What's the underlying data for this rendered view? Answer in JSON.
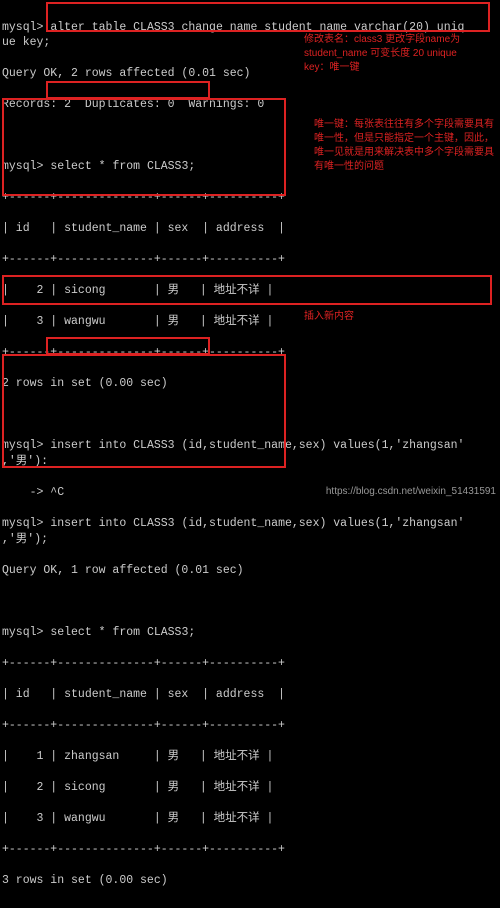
{
  "prompt": "mysql>",
  "statements": {
    "alter": "alter table CLASS3 change name student_name varchar(20) uniq\nue key;",
    "alter_result1": "Query OK, 2 rows affected (0.01 sec)",
    "alter_result2": "Records: 2  Duplicates: 0  Warnings: 0",
    "select1": "select * from CLASS3;",
    "table_border": "+------+--------------+------+----------+",
    "table_header": "| id   | student_name | sex  | address  |",
    "row_sicong": "|    2 | sicong       | 男   | 地址不详 |",
    "row_wangwu": "|    3 | wangwu       | 男   | 地址不详 |",
    "rows_in_set2": "2 rows in set (0.00 sec)",
    "insert_bad": "insert into CLASS3 (id,student_name,sex) values(1,'zhangsan'\n,'男'):",
    "cancel": "    -> ^C",
    "insert_ok": "insert into CLASS3 (id,student_name,sex) values(1,'zhangsan'\n,'男');",
    "insert_result": "Query OK, 1 row affected (0.01 sec)",
    "select2": "select * from CLASS3;",
    "row_zhangsan": "|    1 | zhangsan     | 男   | 地址不详 |",
    "rows_in_set3": "3 rows in set (0.00 sec)"
  },
  "annotations": {
    "alter_note": "修改表名：class3 更改字段name为 student_name 可变长度 20 unique key：唯一键",
    "unique_note": "唯一键：每张表往往有多个字段需要具有唯一性，但是只能指定一个主键，因此，唯一见就是用来解决表中多个字段需要具有唯一性的问题",
    "insert_note": "插入新内容"
  },
  "watermark": "https://blog.csdn.net/weixin_51431591"
}
